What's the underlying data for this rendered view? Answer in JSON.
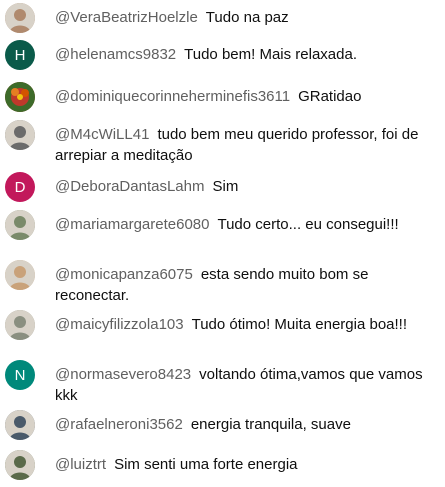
{
  "chat": {
    "messages": [
      {
        "author": "@VeraBeatrizHoelzle",
        "text": "Tudo na paz",
        "avatar": {
          "type": "photo",
          "icon": "user-photo-avatar",
          "color": "#b08a6e"
        }
      },
      {
        "author": "@helenamcs9832",
        "text": "Tudo bem! Mais relaxada.",
        "avatar": {
          "type": "letter",
          "letter": "H",
          "color": "#0b5b4a"
        }
      },
      {
        "author": "@dominiquecorinneherminefis3611",
        "text": "GRatidao",
        "avatar": {
          "type": "photo",
          "icon": "flower-photo-avatar",
          "color": "#c0392b"
        }
      },
      {
        "author": "@M4cWiLL41",
        "text": "tudo bem meu querido professor, foi de arrepiar a meditação",
        "avatar": {
          "type": "photo",
          "icon": "user-photo-avatar",
          "color": "#6b6b6b"
        }
      },
      {
        "author": "@DeboraDantasLahm",
        "text": "Sim",
        "avatar": {
          "type": "letter",
          "letter": "D",
          "color": "#c2185b"
        }
      },
      {
        "author": "@mariamargarete6080",
        "text": "Tudo certo... eu consegui!!!",
        "avatar": {
          "type": "photo",
          "icon": "user-photo-avatar",
          "color": "#7a8a6a"
        }
      },
      {
        "author": "@monicapanza6075",
        "text": "esta sendo muito bom se reconectar.",
        "avatar": {
          "type": "photo",
          "icon": "user-photo-avatar",
          "color": "#c9a27a"
        }
      },
      {
        "author": "@maicyfilizzola103",
        "text": "Tudo ótimo! Muita energia boa!!!",
        "avatar": {
          "type": "photo",
          "icon": "user-photo-avatar",
          "color": "#8a8f80"
        }
      },
      {
        "author": "@normasevero8423",
        "text": "voltando ótima,vamos que vamos kkk",
        "avatar": {
          "type": "letter",
          "letter": "N",
          "color": "#00897b"
        }
      },
      {
        "author": "@rafaelneroni3562",
        "text": "energia tranquila, suave",
        "avatar": {
          "type": "photo",
          "icon": "user-photo-avatar",
          "color": "#4a5a6a"
        }
      },
      {
        "author": "@luiztrt",
        "text": "Sim senti uma forte energia",
        "avatar": {
          "type": "photo",
          "icon": "user-photo-avatar",
          "color": "#5a6a4a"
        }
      }
    ]
  }
}
